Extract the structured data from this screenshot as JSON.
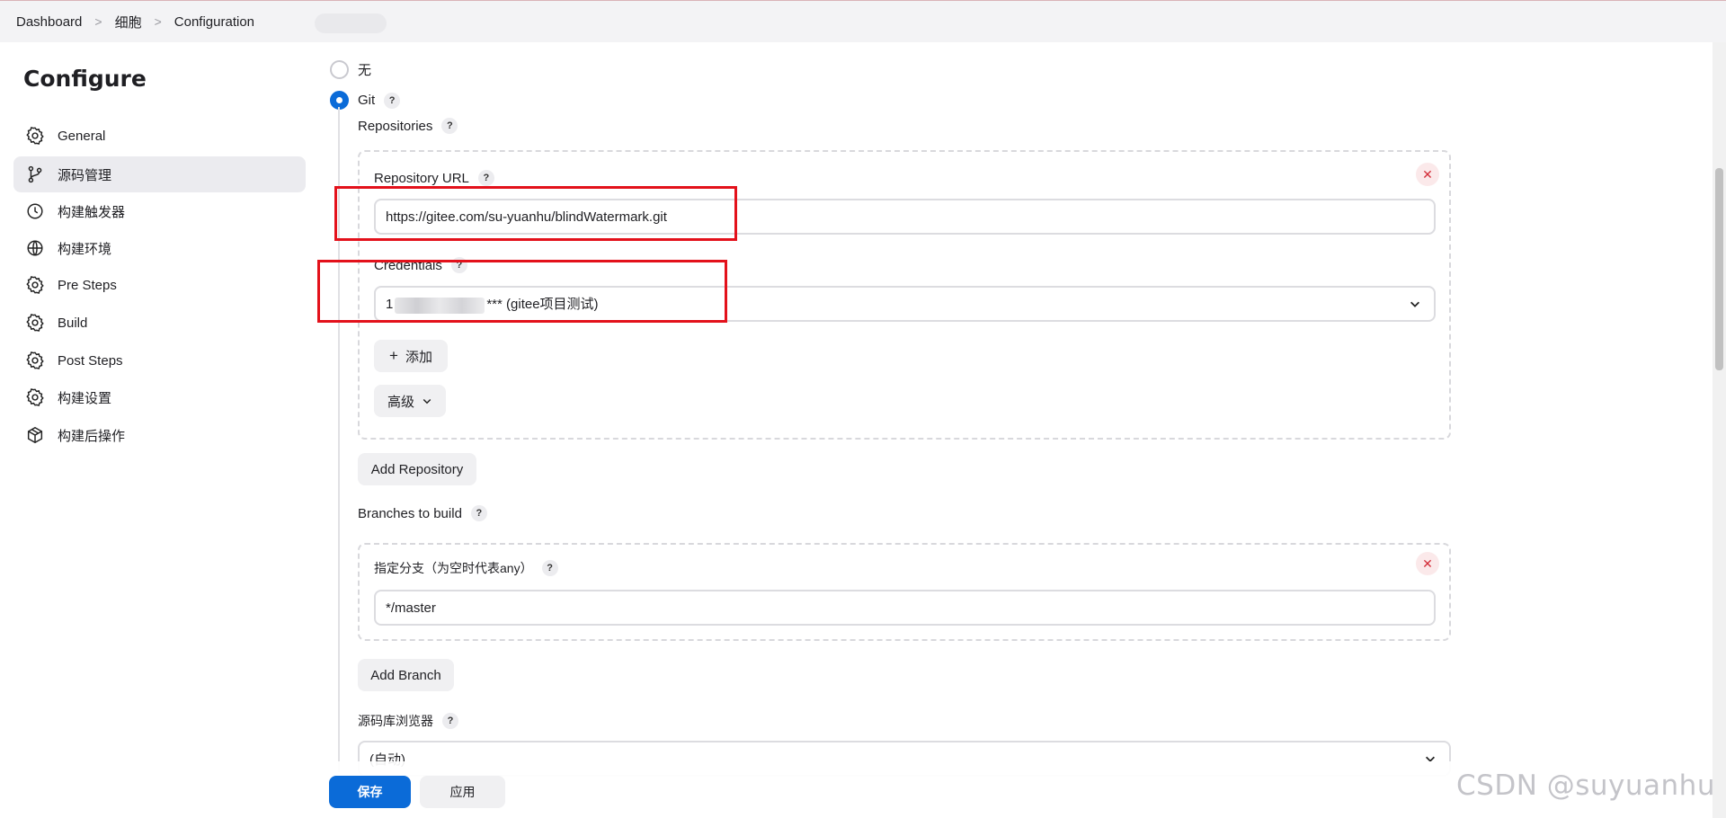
{
  "breadcrumb": [
    "Dashboard",
    "细胞",
    "Configuration"
  ],
  "sidebar": {
    "title": "Configure",
    "items": [
      {
        "label": "General",
        "icon": "gear-icon"
      },
      {
        "label": "源码管理",
        "icon": "branch-icon"
      },
      {
        "label": "构建触发器",
        "icon": "clock-icon"
      },
      {
        "label": "构建环境",
        "icon": "globe-icon"
      },
      {
        "label": "Pre Steps",
        "icon": "gear-icon"
      },
      {
        "label": "Build",
        "icon": "gear-icon"
      },
      {
        "label": "Post Steps",
        "icon": "gear-icon"
      },
      {
        "label": "构建设置",
        "icon": "gear-icon"
      },
      {
        "label": "构建后操作",
        "icon": "cube-icon"
      }
    ]
  },
  "scm": {
    "option_none": "无",
    "option_git": "Git",
    "help": "?",
    "repositories_label": "Repositories",
    "repo_url_label": "Repository URL",
    "repo_url_value": "https://gitee.com/su-yuanhu/blindWatermark.git",
    "credentials_label": "Credentials",
    "credentials_prefix": "1",
    "credentials_suffix": "*** (gitee项目测试)",
    "add_label": "添加",
    "advanced_label": "高级",
    "add_repository": "Add Repository",
    "branches_label": "Branches to build",
    "branch_spec_label": "指定分支（为空时代表any）",
    "branch_spec_value": "*/master",
    "add_branch": "Add Branch",
    "browser_label": "源码库浏览器",
    "browser_value": "(自动)",
    "remove_symbol": "✕"
  },
  "footer": {
    "save": "保存",
    "apply": "应用"
  },
  "watermark": "CSDN @suyuanhu",
  "colors": {
    "primary": "#0b6bd8",
    "highlight": "#e3111b",
    "danger": "#d32f3a"
  }
}
